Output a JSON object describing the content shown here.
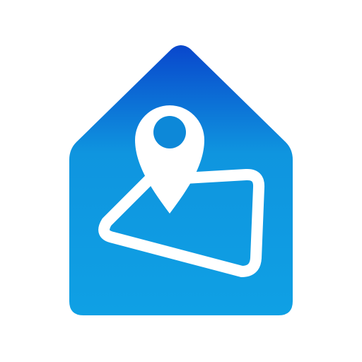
{
  "icon": {
    "name": "house-map-pin-icon",
    "colors": {
      "background": "#ffffff",
      "house_top": "#0947cc",
      "house_bottom": "#0fa0e4",
      "glyph": "#ffffff"
    }
  }
}
